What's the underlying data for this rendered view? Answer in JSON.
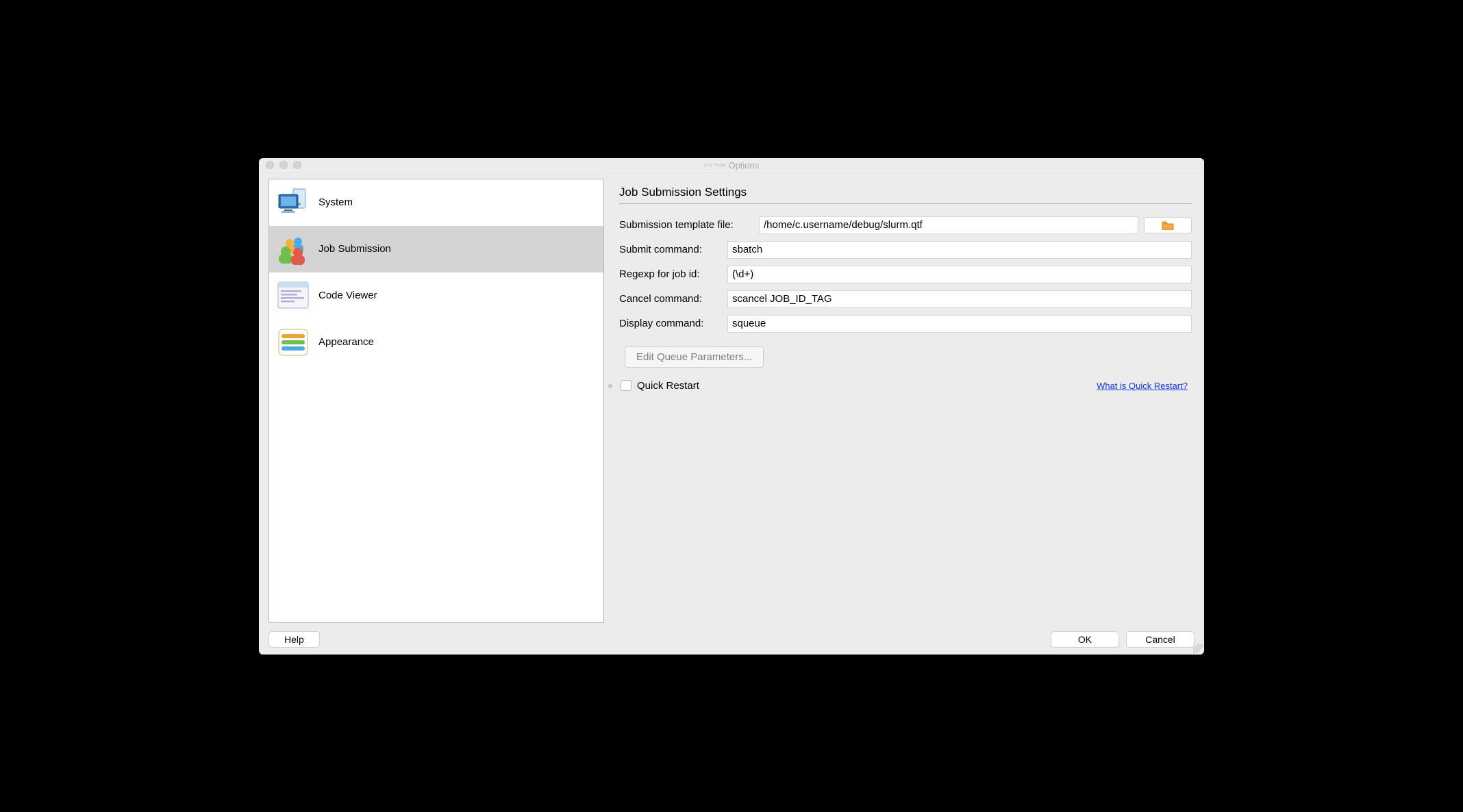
{
  "window": {
    "title": "Options",
    "logo_text": "arm FORGE"
  },
  "sidebar": {
    "items": [
      {
        "label": "System",
        "icon": "system",
        "selected": false
      },
      {
        "label": "Job Submission",
        "icon": "jobs",
        "selected": true
      },
      {
        "label": "Code Viewer",
        "icon": "viewer",
        "selected": false
      },
      {
        "label": "Appearance",
        "icon": "appearance",
        "selected": false
      }
    ]
  },
  "main": {
    "heading": "Job Submission Settings",
    "template_label": "Submission template file:",
    "template_value": "/home/c.username/debug/slurm.qtf",
    "submit_label": "Submit command:",
    "submit_value": "sbatch",
    "regex_label": "Regexp for job id:",
    "regex_value": "(\\d+)",
    "cancel_label": "Cancel command:",
    "cancel_value": "scancel JOB_ID_TAG",
    "display_label": "Display command:",
    "display_value": "squeue",
    "edit_queue_label": "Edit Queue Parameters...",
    "quick_restart_label": "Quick Restart",
    "quick_restart_checked": false,
    "quick_restart_link": "What is Quick Restart?"
  },
  "footer": {
    "help": "Help",
    "ok": "OK",
    "cancel": "Cancel"
  }
}
